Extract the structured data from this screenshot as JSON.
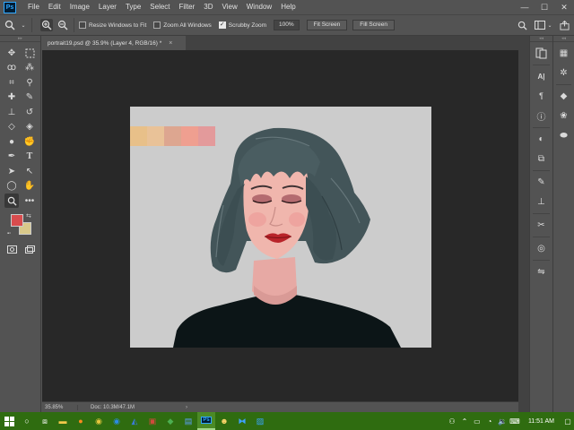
{
  "app": {
    "logo_text": "Ps",
    "brand_color": "#31a8ff"
  },
  "menu": [
    "File",
    "Edit",
    "Image",
    "Layer",
    "Type",
    "Select",
    "Filter",
    "3D",
    "View",
    "Window",
    "Help"
  ],
  "window_controls": {
    "minimize": "—",
    "maximize": "☐",
    "close": "✕"
  },
  "options_bar": {
    "tool_icon": "zoom-icon",
    "resize_windows_label": "Resize Windows to Fit",
    "resize_windows_checked": false,
    "zoom_all_label": "Zoom All Windows",
    "zoom_all_checked": false,
    "scrubby_zoom_label": "Scrubby Zoom",
    "scrubby_zoom_checked": true,
    "zoom_value": "100%",
    "fit_screen_label": "Fit Screen",
    "fill_screen_label": "Fill Screen"
  },
  "document": {
    "tab_title": "portrait19.psd @ 35.9% (Layer 4, RGB/16) *",
    "close_glyph": "×",
    "palette_colors": [
      "#e8c089",
      "#e9c298",
      "#dda690",
      "#ef9f90",
      "#e39a9b"
    ]
  },
  "status_bar": {
    "zoom": "35.85%",
    "doc_size": "Doc: 10.3M/47.1M",
    "arrow": "›"
  },
  "colors": {
    "foreground": "#d94c4e",
    "background": "#d9c98a"
  },
  "taskbar": {
    "time": "11:51 AM"
  }
}
